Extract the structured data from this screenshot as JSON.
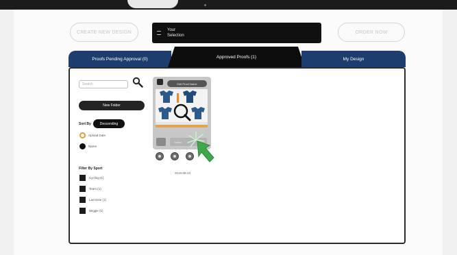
{
  "header": {
    "create_label": "CREATE NEW DESIGN",
    "selection_label": "Your Selection",
    "order_label": "ORDER NOW"
  },
  "tabs": [
    {
      "label": "Proofs Pending Approval (0)",
      "active": false
    },
    {
      "label": "Approved Proofs (1)",
      "active": true
    },
    {
      "label": "My Design",
      "active": false
    }
  ],
  "sidebar": {
    "search_placeholder": "Search",
    "new_folder_label": "New Folder",
    "sort_by_label": "Sort By",
    "sort_order": "Descending",
    "sort_options": [
      "Upload Date",
      "Name"
    ],
    "filter_label": "Filter By Sport",
    "filters": [
      "Cycling (1)",
      "Team (1)",
      "Lacrosse (1)",
      "Wiggle (1)"
    ]
  },
  "card": {
    "edit_label": "Edit Proof Name",
    "action_label": "Select",
    "date": "2016-08-23"
  },
  "colors": {
    "tab_blue": "#1c3d6e",
    "tab_active": "#0d0d0d",
    "accent_orange": "#e79a3c",
    "cursor_green": "#3ea84a"
  }
}
